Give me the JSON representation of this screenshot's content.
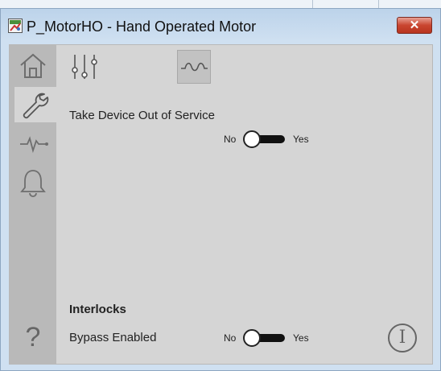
{
  "window": {
    "title": "P_MotorHO - Hand Operated Motor",
    "close_glyph": "✕",
    "app_icon": "faceplate-app-icon"
  },
  "sidebar": {
    "items": [
      {
        "name": "home",
        "icon": "home-icon",
        "active": false
      },
      {
        "name": "maintenance",
        "icon": "wrench-icon",
        "active": true
      },
      {
        "name": "trends",
        "icon": "trend-icon",
        "active": false
      },
      {
        "name": "alarms",
        "icon": "bell-icon",
        "active": false
      }
    ],
    "help_glyph": "?"
  },
  "toolbar": {
    "buttons": [
      {
        "name": "parameters",
        "icon": "sliders-icon"
      },
      {
        "name": "bypass",
        "icon": "bypass-icon"
      }
    ]
  },
  "oos": {
    "label": "Take Device Out of Service",
    "no": "No",
    "yes": "Yes"
  },
  "interlocks": {
    "title": "Interlocks",
    "bypass_label": "Bypass Enabled",
    "no": "No",
    "yes": "Yes"
  },
  "info": {
    "glyph": "I",
    "icon": "info-icon"
  },
  "colors": {
    "close_button": "#c9452f",
    "sidebar": "#b9b9b9",
    "panel": "#d5d5d5",
    "toggle_track": "#111111"
  }
}
